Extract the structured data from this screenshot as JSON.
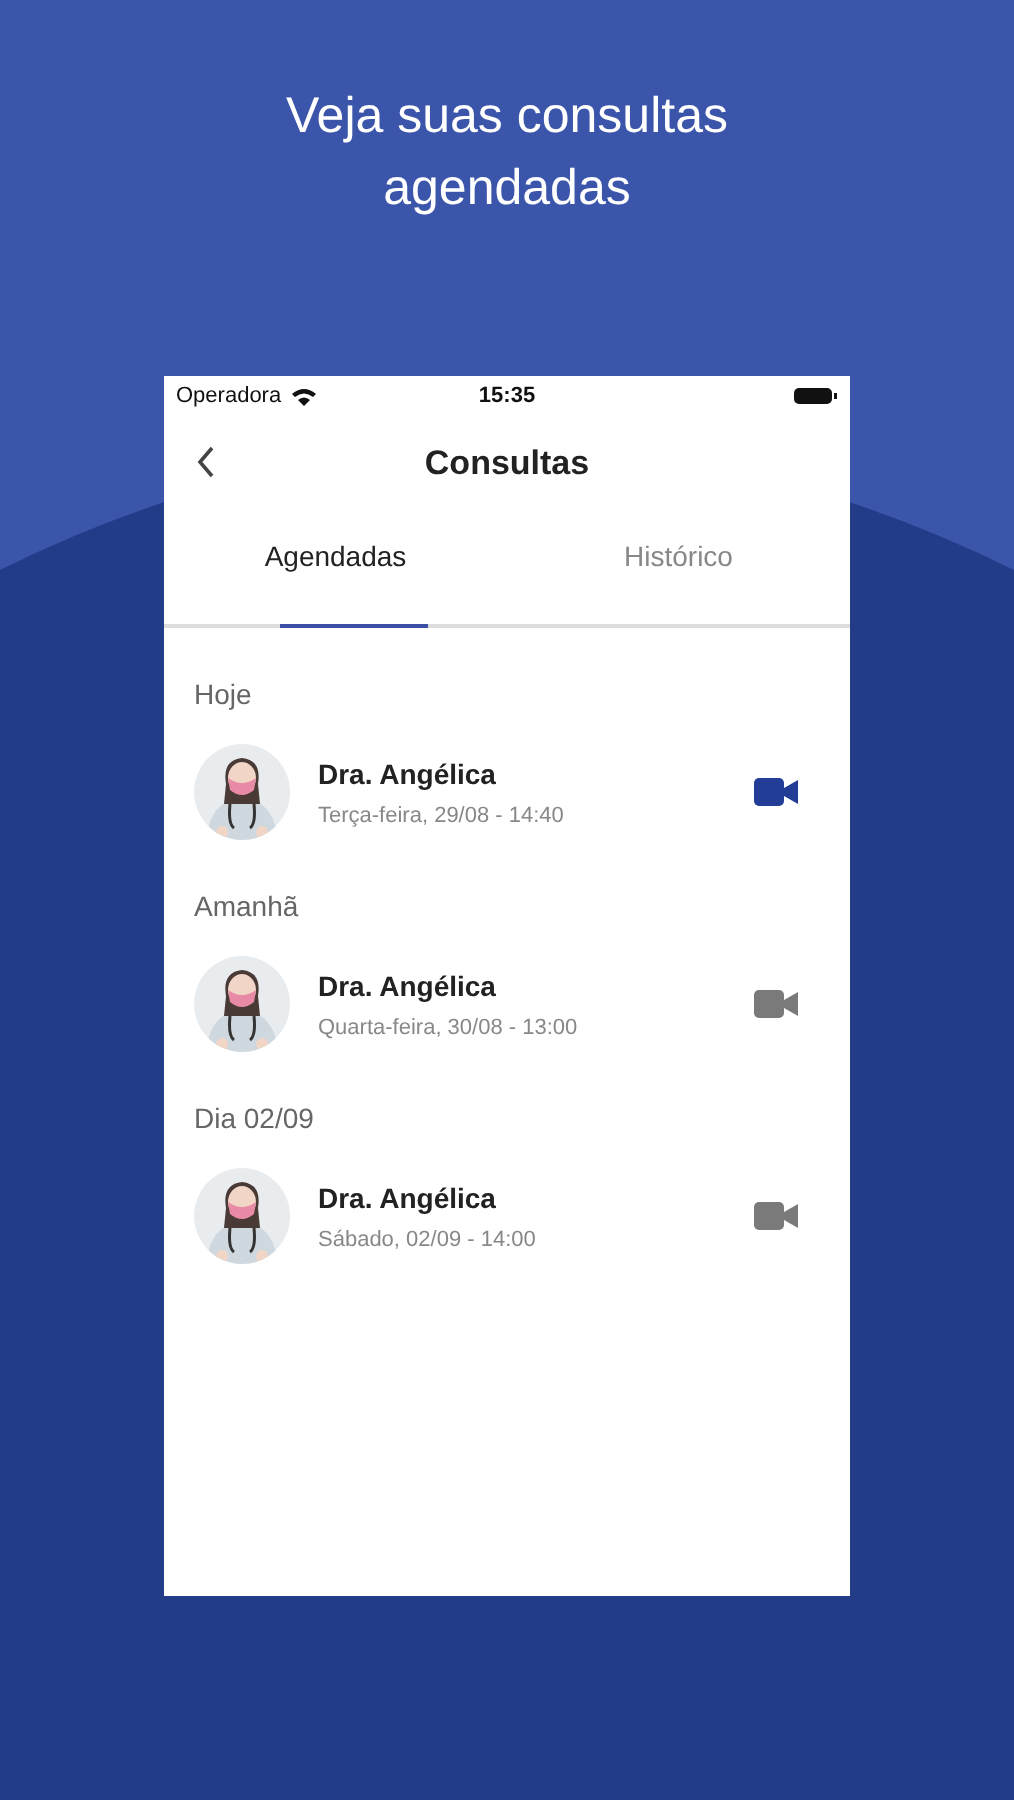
{
  "headline": "Veja suas consultas agendadas",
  "status_bar": {
    "carrier": "Operadora",
    "time": "15:35"
  },
  "header": {
    "title": "Consultas"
  },
  "tabs": [
    {
      "label": "Agendadas",
      "selected": true
    },
    {
      "label": "Histórico",
      "selected": false
    }
  ],
  "groups": [
    {
      "heading": "Hoje",
      "items": [
        {
          "doctor": "Dra. Angélica",
          "when": "Terça-feira, 29/08 - 14:40",
          "video_active": true
        }
      ]
    },
    {
      "heading": "Amanhã",
      "items": [
        {
          "doctor": "Dra. Angélica",
          "when": "Quarta-feira, 30/08 - 13:00",
          "video_active": false
        }
      ]
    },
    {
      "heading": "Dia 02/09",
      "items": [
        {
          "doctor": "Dra. Angélica",
          "when": "Sábado, 02/09 - 14:00",
          "video_active": false
        }
      ]
    }
  ]
}
